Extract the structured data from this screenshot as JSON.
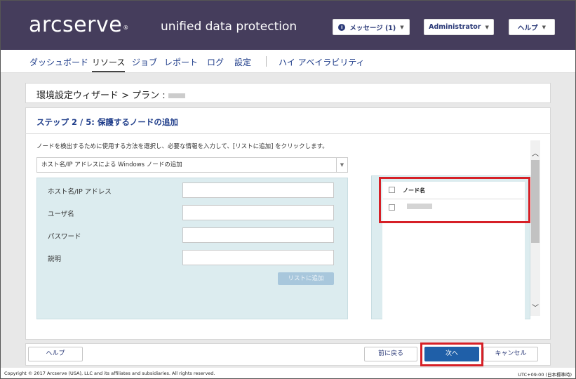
{
  "header": {
    "logo": "arcserve",
    "logo_mark": "®",
    "product": "unified data protection",
    "messages_label": "メッセージ (1)",
    "user_label": "Administrator",
    "help_label": "ヘルプ",
    "bg_color": "#453d5c"
  },
  "nav": {
    "items": [
      "ダッシュボード",
      "リソース",
      "ジョブ",
      "レポート",
      "ログ",
      "設定",
      "ハイ アベイラビリティ"
    ],
    "active": "リソース"
  },
  "wizard": {
    "title": "環境設定ウィザード > プラン :"
  },
  "step": {
    "title": "ステップ 2 / 5: 保護するノードの追加",
    "instruction": "ノードを検出するために使用する方法を選択し、必要な情報を入力して、[リストに追加] をクリックします。",
    "method_selected": "ホスト名/IP アドレスによる Windows ノードの追加"
  },
  "form": {
    "hostname_label": "ホスト名/IP アドレス",
    "username_label": "ユーザ名",
    "password_label": "パスワード",
    "description_label": "説明",
    "add_button": "リストに追加"
  },
  "node_list": {
    "column_header": "ノード名"
  },
  "footer": {
    "help": "ヘルプ",
    "back": "前に戻る",
    "next": "次へ",
    "cancel": "キャンセル",
    "copyright": "Copyright © 2017 Arcserve (USA), LLC and its affiliates and subsidiaries. All rights reserved.",
    "timezone": "UTC+09:00 (日本標準時)"
  },
  "colors": {
    "accent": "#1f5fa8",
    "highlight": "#d62027",
    "nav_text": "#1f3d8a"
  }
}
